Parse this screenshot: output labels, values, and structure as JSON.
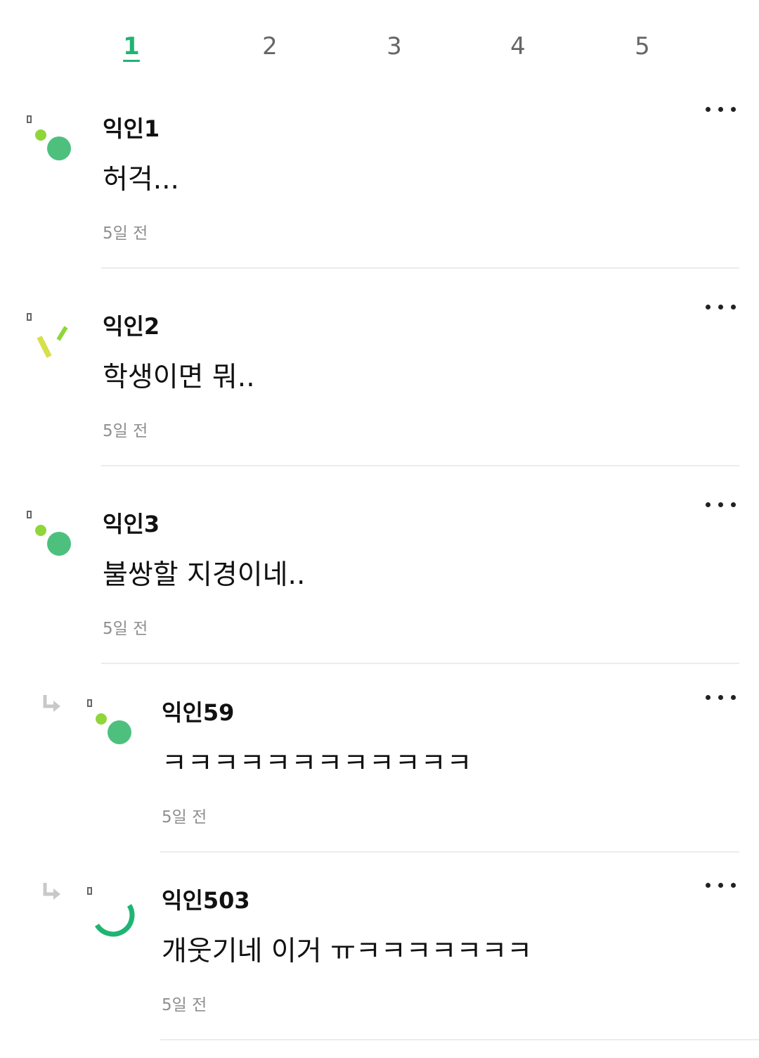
{
  "pagination": {
    "pages": [
      "1",
      "2",
      "3",
      "4",
      "5"
    ],
    "active": "1"
  },
  "comments": [
    {
      "author": "익인1",
      "text": "허걱...",
      "time": "5일 전",
      "avatar": "dots-avatar",
      "reply": false
    },
    {
      "author": "익인2",
      "text": "학생이면 뭐..",
      "time": "5일 전",
      "avatar": "slash-avatar",
      "reply": false
    },
    {
      "author": "익인3",
      "text": "불쌍할 지경이네..",
      "time": "5일 전",
      "avatar": "dots-avatar",
      "reply": false
    },
    {
      "author": "익인59",
      "text": "ㅋㅋㅋㅋㅋㅋㅋㅋㅋㅋㅋㅋ",
      "time": "5일 전",
      "avatar": "dots-avatar",
      "reply": true
    },
    {
      "author": "익인503",
      "text": "개웃기네 이거 ㅠㅋㅋㅋㅋㅋㅋㅋ",
      "time": "5일 전",
      "avatar": "arc-avatar",
      "reply": true
    }
  ],
  "colors": {
    "accent": "#1fb472",
    "avatar_green": "#4ec07e",
    "avatar_lime": "#8fd63a",
    "avatar_yellow": "#d6e04a"
  },
  "icons": {
    "more": "more-horizontal-icon",
    "reply": "reply-arrow-icon"
  }
}
